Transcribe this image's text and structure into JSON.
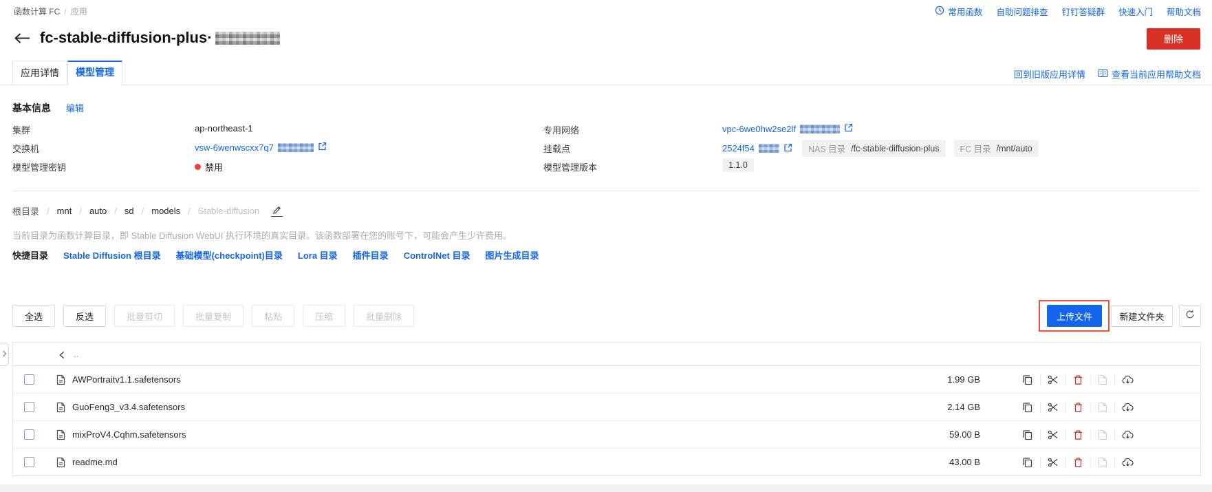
{
  "colors": {
    "accent": "#1366ec",
    "danger": "#d93026",
    "highlight_box": "#f3503c",
    "disabled_dot": "#f04134"
  },
  "topbar": {
    "breadcrumb": {
      "root": "函数计算 FC",
      "current": "应用"
    },
    "links": [
      "常用函数",
      "自助问题排查",
      "钉钉答疑群",
      "快速入门",
      "帮助文档"
    ]
  },
  "header": {
    "title": "fc-stable-diffusion-plus·",
    "delete_button": "删除"
  },
  "tabs": {
    "app_detail": "应用详情",
    "model_manage": "模型管理"
  },
  "tab_links": {
    "old_version": "回到旧版应用详情",
    "help_doc": "查看当前应用帮助文档"
  },
  "basic_info": {
    "title": "基本信息",
    "edit": "编辑",
    "cluster": {
      "label": "集群",
      "value": "ap-northeast-1"
    },
    "vpc": {
      "label": "专用网络",
      "value": "vpc-6we0hw2se2lf"
    },
    "vswitch": {
      "label": "交换机",
      "value": "vsw-6wenwscxx7q7"
    },
    "mount": {
      "label": "挂载点",
      "value": "2524f54",
      "nas_label": "NAS 目录",
      "nas_path": "/fc-stable-diffusion-plus",
      "fc_label": "FC 目录",
      "fc_path": "/mnt/auto"
    },
    "key": {
      "label": "模型管理密钥",
      "status": "禁用"
    },
    "version": {
      "label": "模型管理版本",
      "value": "1.1.0"
    }
  },
  "path_bar": {
    "crumbs": [
      "根目录",
      "mnt",
      "auto",
      "sd",
      "models",
      "Stable-diffusion"
    ]
  },
  "notice": "当前目录为函数计算目录，即 Stable Diffusion WebUI 执行环境的真实目录。该函数部署在您的账号下，可能会产生少许费用。",
  "quick_dirs": {
    "label": "快捷目录",
    "links": [
      "Stable Diffusion 根目录",
      "基础模型(checkpoint)目录",
      "Lora 目录",
      "插件目录",
      "ControlNet 目录",
      "图片生成目录"
    ]
  },
  "toolbar": {
    "select_all": "全选",
    "invert_select": "反选",
    "batch_cut": "批量剪切",
    "batch_copy": "批量复制",
    "paste": "粘贴",
    "compress": "压缩",
    "batch_delete": "批量删除",
    "upload": "上传文件",
    "new_folder": "新建文件夹"
  },
  "file_table": {
    "parent": "..",
    "rows": [
      {
        "name": "AWPortraitv1.1.safetensors",
        "size": "1.99 GB"
      },
      {
        "name": "GuoFeng3_v3.4.safetensors",
        "size": "2.14 GB"
      },
      {
        "name": "mixProV4.Cqhm.safetensors",
        "size": "59.00 B"
      },
      {
        "name": "readme.md",
        "size": "43.00 B"
      }
    ],
    "row_action_icons": [
      "copy",
      "cut",
      "delete",
      "file",
      "download"
    ]
  }
}
